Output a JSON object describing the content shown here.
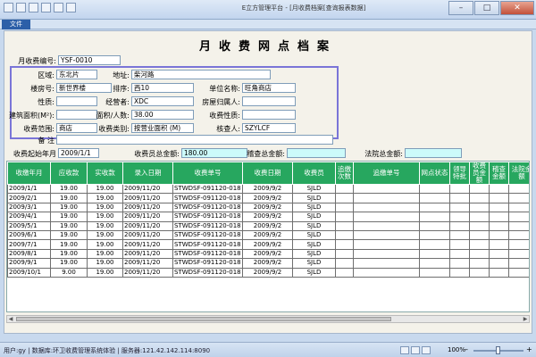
{
  "window": {
    "title": "E立方管理平台 - [月收费档案[查询报表数据]",
    "controls": {
      "minimize": "–",
      "maximize": "□",
      "close": "✕"
    }
  },
  "ribbon": {
    "file_tab": "文件"
  },
  "form": {
    "title": "月收费网点档案",
    "code_label": "月收费编号:",
    "code_value": "YSF-0010",
    "region_label": "区域:",
    "region_value": "东北片",
    "address_label": "地址:",
    "address_value": "柴河路",
    "building_label": "楼房号:",
    "building_value": "新世界楼",
    "order_label": "排序:",
    "order_value": "西10",
    "unit_label": "单位名称:",
    "unit_value": "旺角商店",
    "nature_label": "性质:",
    "nature_value": "",
    "operator_label": "经营者:",
    "operator_value": "XDC",
    "owner_label": "房屋归属人:",
    "owner_value": "",
    "area_label": "建筑面积(M²):",
    "area_value": "",
    "area_per_label": "面积/人数:",
    "area_per_value": "38.00",
    "fee_nature_label": "收费性质:",
    "fee_nature_value": "",
    "scope_label": "收费范围:",
    "scope_value": "商店",
    "category_label": "收费类别:",
    "category_value": "按营业面积 (M)",
    "checker_label": "核查人:",
    "checker_value": "SZYLCF",
    "remark_label": "备  注",
    "remark_value": "",
    "start_month_label": "收费起始年月",
    "start_month_value": "2009/1/1",
    "collector_total_label": "收费员总金额:",
    "collector_total_value": "180.00",
    "audit_total_label": "稽查总金额:",
    "audit_total_value": "",
    "court_total_label": "法院总金额:",
    "court_total_value": ""
  },
  "table": {
    "headers": [
      "收缴年月",
      "应收款",
      "实收款",
      "录入日期",
      "收费单号",
      "收费日期",
      "收费员",
      "追缴次数",
      "追缴单号",
      "网点状态",
      "领导特批",
      "收费员金额",
      "稽查金额",
      "法院金额"
    ],
    "rows": [
      [
        "2009/1/1",
        "19.00",
        "19.00",
        "2009/11/20",
        "STWDSF-091120-018",
        "2009/9/2",
        "SJLD",
        "",
        "",
        "",
        "",
        "",
        "",
        ""
      ],
      [
        "2009/2/1",
        "19.00",
        "19.00",
        "2009/11/20",
        "STWDSF-091120-018",
        "2009/9/2",
        "SJLD",
        "",
        "",
        "",
        "",
        "",
        "",
        ""
      ],
      [
        "2009/3/1",
        "19.00",
        "19.00",
        "2009/11/20",
        "STWDSF-091120-018",
        "2009/9/2",
        "SJLD",
        "",
        "",
        "",
        "",
        "",
        "",
        ""
      ],
      [
        "2009/4/1",
        "19.00",
        "19.00",
        "2009/11/20",
        "STWDSF-091120-018",
        "2009/9/2",
        "SJLD",
        "",
        "",
        "",
        "",
        "",
        "",
        ""
      ],
      [
        "2009/5/1",
        "19.00",
        "19.00",
        "2009/11/20",
        "STWDSF-091120-018",
        "2009/9/2",
        "SJLD",
        "",
        "",
        "",
        "",
        "",
        "",
        ""
      ],
      [
        "2009/6/1",
        "19.00",
        "19.00",
        "2009/11/20",
        "STWDSF-091120-018",
        "2009/9/2",
        "SJLD",
        "",
        "",
        "",
        "",
        "",
        "",
        ""
      ],
      [
        "2009/7/1",
        "19.00",
        "19.00",
        "2009/11/20",
        "STWDSF-091120-018",
        "2009/9/2",
        "SJLD",
        "",
        "",
        "",
        "",
        "",
        "",
        ""
      ],
      [
        "2009/8/1",
        "19.00",
        "19.00",
        "2009/11/20",
        "STWDSF-091120-018",
        "2009/9/2",
        "SJLD",
        "",
        "",
        "",
        "",
        "",
        "",
        ""
      ],
      [
        "2009/9/1",
        "19.00",
        "19.00",
        "2009/11/20",
        "STWDSF-091120-018",
        "2009/9/2",
        "SJLD",
        "",
        "",
        "",
        "",
        "",
        "",
        ""
      ],
      [
        "2009/10/1",
        "9.00",
        "19.00",
        "2009/11/20",
        "STWDSF-091120-018",
        "2009/9/2",
        "SJLD",
        "",
        "",
        "",
        "",
        "",
        "",
        ""
      ]
    ]
  },
  "statusbar": {
    "text": "用户:gy | 数据库:环卫收费管理系统体验 | 服务器:121.42.142.114:8090",
    "zoom": "100%",
    "zoom_minus": "–",
    "zoom_plus": "+"
  },
  "colors": {
    "header_green": "#27a75f",
    "highlight_cyan": "#ccfafa",
    "group_border": "#7a75d8"
  }
}
